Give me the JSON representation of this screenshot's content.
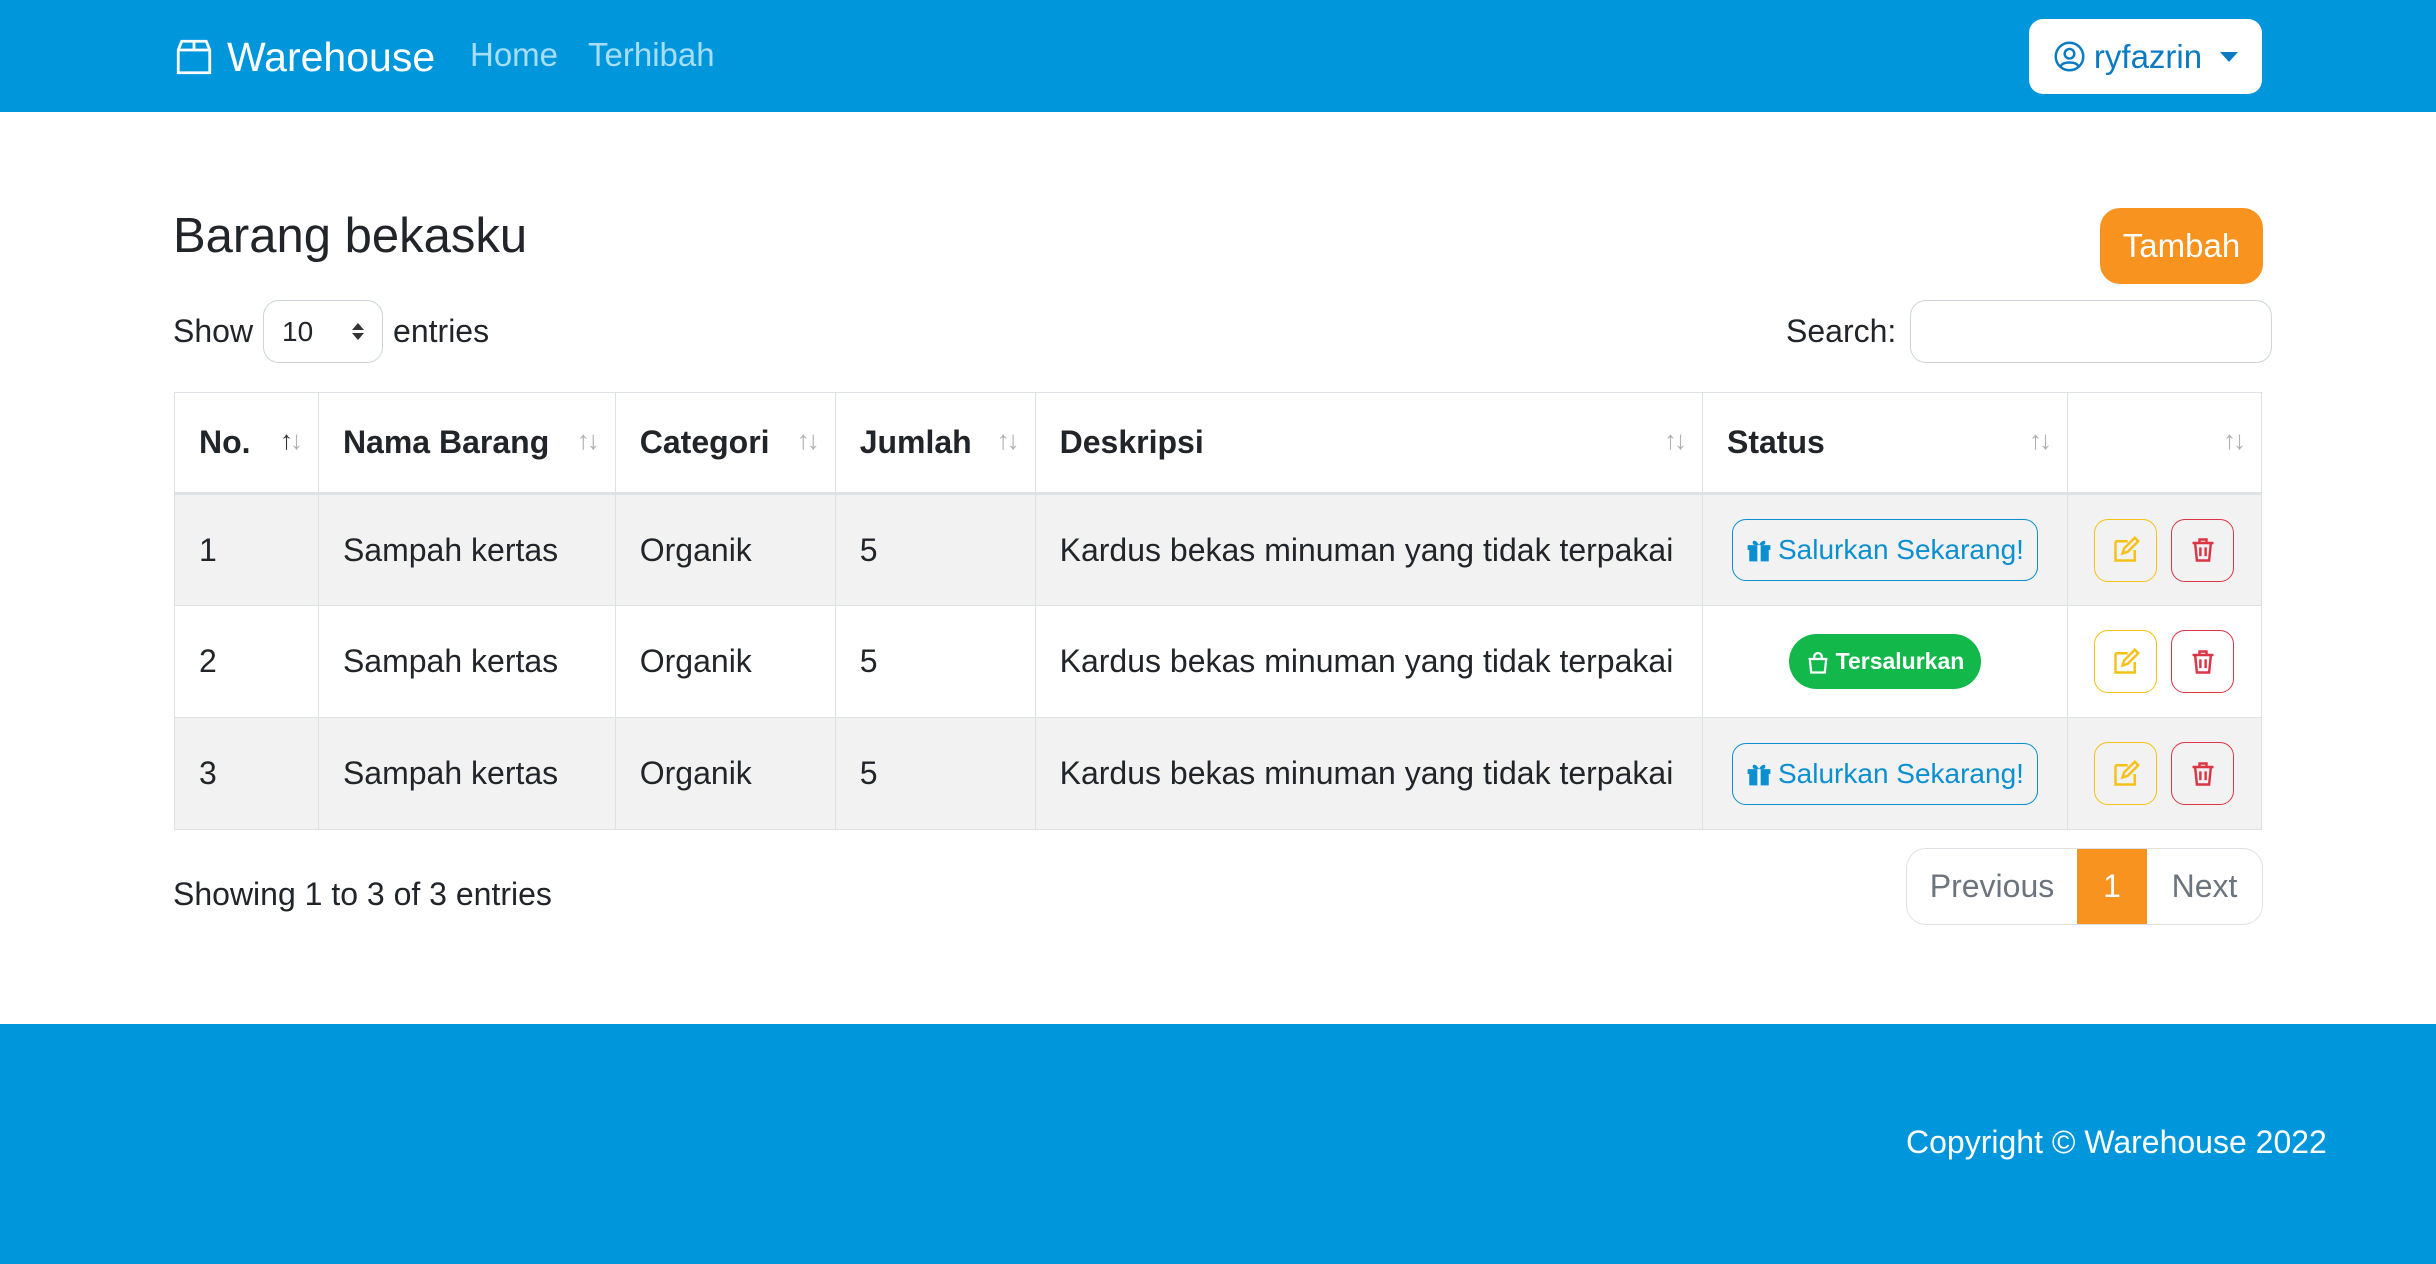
{
  "navbar": {
    "brand": "Warehouse",
    "brand_icon": "box-icon",
    "links": [
      "Home",
      "Terhibah"
    ],
    "user": "ryfazrin",
    "user_icon": "user-circle-icon",
    "background": "#0096dc"
  },
  "main": {
    "title": "Barang bekasku",
    "add_button": "Tambah",
    "show_label": "Show",
    "entries_label": "entries",
    "page_length": "10",
    "search_label": "Search:",
    "search_value": ""
  },
  "table": {
    "headers": [
      "No.",
      "Nama Barang",
      "Categori",
      "Jumlah",
      "Deskripsi",
      "Status",
      ""
    ],
    "rows": [
      {
        "no": "1",
        "nama": "Sampah kertas",
        "kategori": "Organik",
        "jumlah": "5",
        "deskripsi": "Kardus bekas minuman yang tidak terpakai",
        "status": "Salurkan Sekarang!"
      },
      {
        "no": "2",
        "nama": "Sampah kertas",
        "kategori": "Organik",
        "jumlah": "5",
        "deskripsi": "Kardus bekas minuman yang tidak terpakai",
        "status": "Tersalurkan"
      },
      {
        "no": "3",
        "nama": "Sampah kertas",
        "kategori": "Organik",
        "jumlah": "5",
        "deskripsi": "Kardus bekas minuman yang tidak terpakai",
        "status": "Salurkan Sekarang!"
      }
    ]
  },
  "footer_info": {
    "showing": "Showing 1 to 3 of 3 entries",
    "prev": "Previous",
    "current_page": "1",
    "next": "Next"
  },
  "footer": {
    "copyright": "Copyright © Warehouse 2022"
  },
  "colors": {
    "primary": "#0096dc",
    "accent": "#f7931e",
    "success": "#13b84a",
    "danger": "#dc3545",
    "warning": "#f5c116"
  }
}
